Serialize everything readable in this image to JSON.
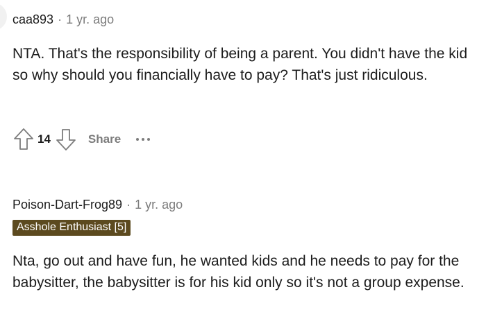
{
  "comments": [
    {
      "username": "caa893",
      "separator": "·",
      "time": "1 yr. ago",
      "body": "NTA. That's the responsibility of being a parent. You didn't have the kid so why should you financially have to pay? That's just ridiculous.",
      "score": "14",
      "share_label": "Share",
      "icons": {
        "upvote": "arrow-up-outline-icon",
        "downvote": "arrow-down-outline-icon",
        "more": "more-horizontal-icon"
      }
    },
    {
      "username": "Poison-Dart-Frog89",
      "separator": "·",
      "time": "1 yr. ago",
      "flair": "Asshole Enthusiast [5]",
      "flair_color": "#5c4a1f",
      "body": "Nta, go out and have fun, he wanted kids and he needs to pay for the babysitter, the babysitter is for his kid only so it's not a group expense."
    }
  ],
  "colors": {
    "text": "#1c1c1c",
    "muted": "#7c7c7c",
    "flair_bg": "#5c4a1f",
    "flair_text": "#ffffff"
  }
}
